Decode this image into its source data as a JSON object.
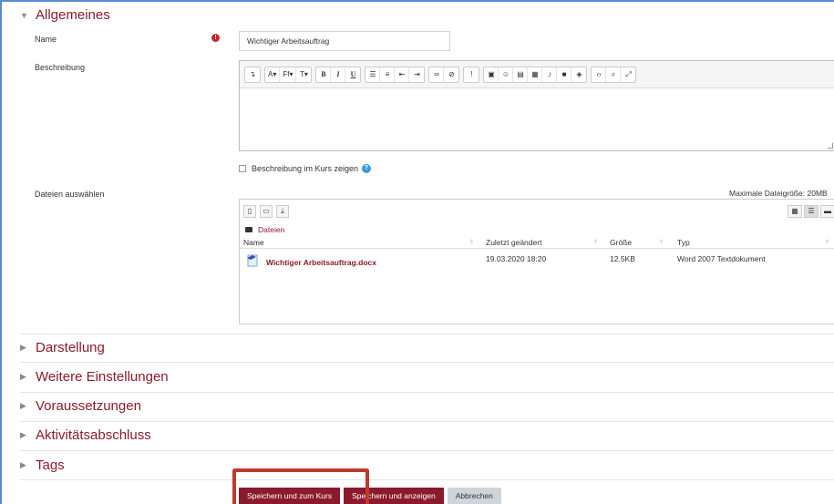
{
  "general": {
    "title": "Allgemeines"
  },
  "name_field": {
    "label": "Name",
    "value": "Wichtiger Arbeitsauftrag"
  },
  "description": {
    "label": "Beschreibung",
    "show_in_course_label": "Beschreibung im Kurs zeigen"
  },
  "files": {
    "label": "Dateien auswählen",
    "max_size": "Maximale Dateigröße: 20MB",
    "path": "Dateien",
    "columns": {
      "name": "Name",
      "modified": "Zuletzt geändert",
      "size": "Größe",
      "type": "Typ"
    },
    "rows": [
      {
        "name": "Wichtiger Arbeitsauftrag.docx",
        "modified": "19.03.2020 18:20",
        "size": "12.5KB",
        "type": "Word 2007 Textdokument"
      }
    ]
  },
  "sections": [
    {
      "title": "Darstellung"
    },
    {
      "title": "Weitere Einstellungen"
    },
    {
      "title": "Voraussetzungen"
    },
    {
      "title": "Aktivitätsabschluss"
    },
    {
      "title": "Tags"
    }
  ],
  "buttons": {
    "save_return": "Speichern und zum Kurs",
    "save_display": "Speichern und anzeigen",
    "cancel": "Abbrechen"
  },
  "colors": {
    "accent": "#8b1a2c",
    "highlight": "#c0392b",
    "help": "#3a9ad9"
  }
}
